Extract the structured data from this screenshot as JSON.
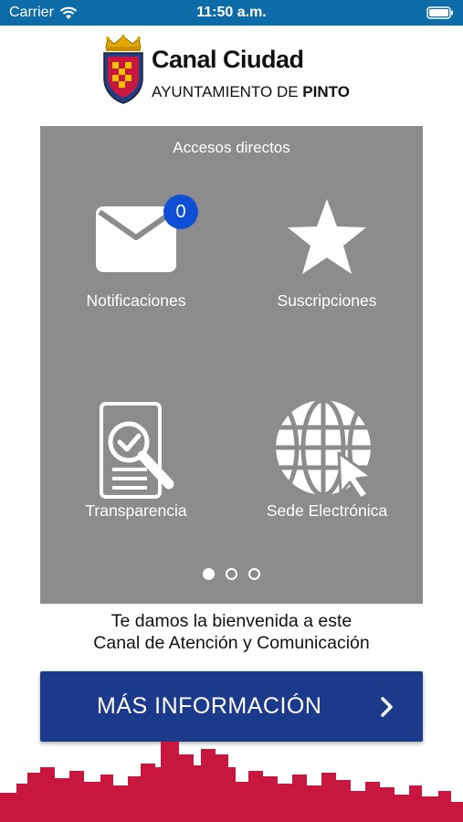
{
  "status_bar": {
    "carrier": "Carrier",
    "time": "11:50 a.m."
  },
  "header": {
    "brand_name": "Canal Ciudad",
    "brand_sub_prefix": "AYUNTAMIENTO DE ",
    "brand_sub_bold": "PINTO"
  },
  "panel": {
    "title": "Accesos directos",
    "tiles": [
      {
        "label": "Notificaciones",
        "icon": "envelope-icon",
        "badge": "0"
      },
      {
        "label": "Suscripciones",
        "icon": "star-icon"
      },
      {
        "label": "Transparencia",
        "icon": "document-search-icon"
      },
      {
        "label": "Sede Electrónica",
        "icon": "globe-cursor-icon"
      }
    ],
    "pager": {
      "pages": 3,
      "current": 1
    }
  },
  "welcome": {
    "line1": "Te damos la bienvenida a este",
    "line2": "Canal de Atención y Comunicación"
  },
  "more_button": {
    "label": "MÁS INFORMACIÓN"
  },
  "colors": {
    "status_bar": "#0d6ba8",
    "panel": "#8c8c8c",
    "badge": "#0e4fd6",
    "button": "#1c3a8c",
    "skyline": "#c8173f"
  }
}
